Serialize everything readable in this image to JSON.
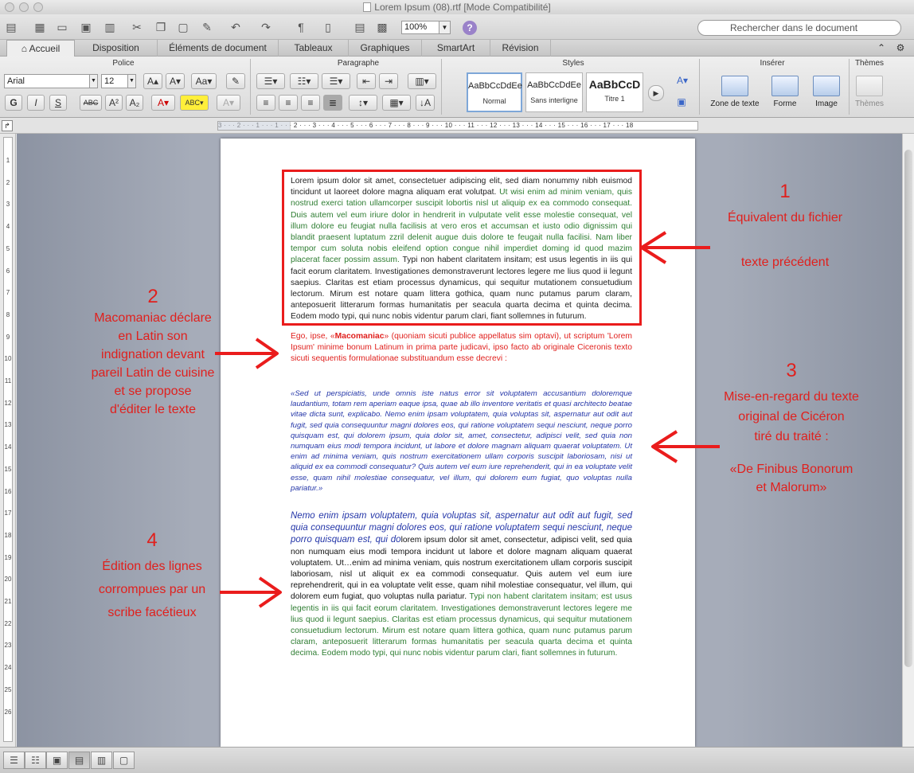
{
  "window": {
    "title": "Lorem Ipsum (08).rtf [Mode Compatibilité]"
  },
  "toolbar": {
    "zoom": "100%",
    "search_placeholder": "Rechercher dans le document"
  },
  "tabs": [
    "Accueil",
    "Disposition",
    "Éléments de document",
    "Tableaux",
    "Graphiques",
    "SmartArt",
    "Révision"
  ],
  "ribbon": {
    "groups": {
      "police": "Police",
      "paragraphe": "Paragraphe",
      "styles": "Styles",
      "inserer": "Insérer",
      "themes": "Thèmes"
    },
    "font_name": "Arial",
    "font_size": "12",
    "styles": [
      {
        "sample": "AaBbCcDdEe",
        "label": "Normal"
      },
      {
        "sample": "AaBbCcDdEe",
        "label": "Sans interligne"
      },
      {
        "sample": "AaBbCcD",
        "label": "Titre 1"
      }
    ],
    "insert": {
      "zone_texte": "Zone de texte",
      "forme": "Forme",
      "image": "Image"
    },
    "themes_btn": "Thèmes"
  },
  "ruler": {
    "h_labels": "3 · · · 2 · · · 1 · · · 1 · · · 2 · · · 3 · · · 4 · · · 5 · · · 6 · · · 7 · · · 8 · · · 9 · · · 10 · · · 11 · · · 12 · · · 13 · · · 14 · · · 15 · · · 16 · · · 17 · · · 18",
    "v_labels": [
      "1",
      "2",
      "3",
      "4",
      "5",
      "6",
      "7",
      "8",
      "9",
      "10",
      "11",
      "12",
      "13",
      "14",
      "15",
      "16",
      "17",
      "18",
      "19",
      "20",
      "21",
      "22",
      "23",
      "24",
      "25",
      "26"
    ]
  },
  "document": {
    "block1_black": "Lorem ipsum dolor sit amet, consectetuer adipiscing elit, sed diam nonummy nibh euismod tincidunt ut laoreet dolore magna aliquam erat volutpat.",
    "block1_green": " Ut wisi enim ad minim veniam, quis nostrud exerci tation ullamcorper suscipit lobortis nisl ut aliquip ex ea commodo consequat. Duis autem vel eum iriure dolor in hendrerit in vulputate velit esse molestie consequat, vel illum dolore eu feugiat nulla facilisis at vero eros et accumsan et iusto odio dignissim qui blandit praesent luptatum zzril delenit augue duis dolore te feugait nulla facilisi. Nam liber tempor cum soluta nobis eleifend option congue nihil imperdiet doming id quod mazim placerat facer possim assum.",
    "block1_tail": " Typi non habent claritatem insitam; est usus legentis in iis qui facit eorum claritatem. Investigationes demonstraverunt lectores legere me lius quod ii legunt saepius. Claritas est etiam processus dynamicus, qui sequitur mutationem consuetudium lectorum. Mirum est notare quam littera gothica, quam nunc putamus parum claram, anteposuerit litterarum formas humanitatis per seacula quarta decima et quinta decima. Eodem modo typi, qui nunc nobis videntur parum clari, fiant sollemnes in futurum.",
    "block2_pre": "Ego, ipse, «",
    "block2_bold": "Macomaniac",
    "block2_post": "» (quoniam sicuti publice appellatus sim optavi), ut scriptum 'Lorem Ipsum' minime bonum Latinum in prima parte judicavi, ipso facto ab originale Ciceronis texto sicuti sequentis formulationae substituandum esse decrevi :",
    "block3": "«Sed ut perspiciatis, unde omnis iste natus error sit voluptatem accusantium doloremque laudantium, totam rem aperiam eaque ipsa, quae ab illo inventore veritatis et quasi architecto beatae vitae dicta sunt, explicabo. Nemo enim ipsam voluptatem, quia voluptas sit, aspernatur aut odit aut fugit, sed quia consequuntur magni dolores eos, qui ratione voluptatem sequi nesciunt, neque porro quisquam est, qui dolorem ipsum, quia dolor sit, amet, consectetur, adipisci velit, sed quia non numquam eius modi tempora incidunt, ut labore et dolore magnam aliquam quaerat voluptatem. Ut enim ad minima veniam, quis nostrum exercitationem ullam corporis suscipit laboriosam, nisi ut aliquid ex ea commodi consequatur? Quis autem vel eum iure reprehenderit, qui in ea voluptate velit esse, quam nihil molestiae consequatur, vel illum, qui dolorem eum fugiat, quo voluptas nulla pariatur.»",
    "block4_it": "Nemo enim ipsam voluptatem, quia voluptas sit, aspernatur aut odit aut fugit, sed quia consequuntur magni dolores eos, qui ratione voluptatem sequi nesciunt, neque porro quisquam est, qui do",
    "block4_mid": "lorem ipsum dolor sit amet, consectetur, adipisci velit, sed quia non numquam eius modi tempora incidunt ut labore et dolore magnam aliquam quaerat voluptatem. Ut…enim ad minima veniam, quis nostrum exercitationem ullam corporis suscipit laboriosam, nisl ut aliquit ex ea commodi consequatur. Quis autem vel eum iure reprehendrerit, qui in ea voluptate velit esse, quam nihil molestiae consequatur, vel illum, qui dolorem eum fugiat, quo voluptas nulla pariatur.",
    "block4_green": " Typi non habent claritatem insitam; est usus legentis in iis qui facit eorum claritatem. Investigationes demonstraverunt lectores legere me lius quod ii legunt saepius. Claritas est etiam processus dynamicus, qui sequitur mutationem consuetudium lectorum. Mirum est notare quam littera gothica, quam nunc putamus parum claram, anteposuerit litterarum formas humanitatis per seacula quarta decima et quinta decima. Eodem modo typi, qui nunc nobis videntur parum clari, fiant sollemnes in futurum."
  },
  "annotations": {
    "a1": {
      "num": "1",
      "l1": "Équivalent du fichier",
      "l2": "texte précédent"
    },
    "a2": {
      "num": "2",
      "l1": "Macomaniac déclare",
      "l2": "en Latin son",
      "l3": "indignation devant",
      "l4": "pareil Latin de cuisine",
      "l5": "et se propose",
      "l6": "d'éditer le texte"
    },
    "a3": {
      "num": "3",
      "l1": "Mise-en-regard du texte",
      "l2": "original de Cicéron",
      "l3": "tiré du traité :",
      "l4": "«De Finibus Bonorum",
      "l5": "et Malorum»"
    },
    "a4": {
      "num": "4",
      "l1": "Édition des lignes",
      "l2": "corrompues par un",
      "l3": "scribe facétieux"
    }
  },
  "colors": {
    "annotation_red": "#e0201d",
    "text_green": "#2e7d32",
    "text_blue": "#2436a8"
  }
}
